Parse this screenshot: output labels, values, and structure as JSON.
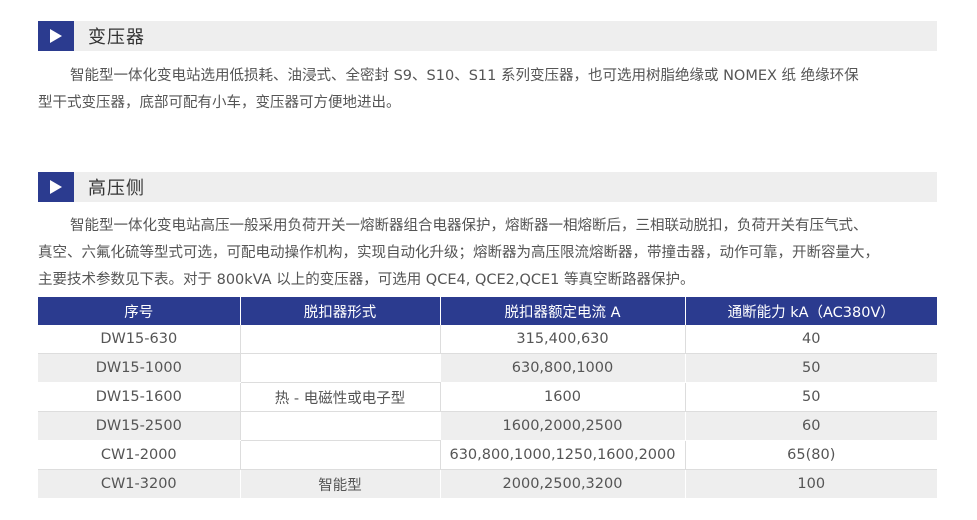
{
  "sections": [
    {
      "title": "变压器",
      "paragraph_lines": [
        "智能型一体化变电站选用低损耗、油浸式、全密封 S9、S10、S11 系列变压器，也可选用树脂绝缘或 NOMEX 纸 绝缘环保",
        "型干式变压器，底部可配有小车，变压器可方便地进出。"
      ]
    },
    {
      "title": "高压侧",
      "paragraph_lines": [
        "智能型一体化变电站高压一般采用负荷开关一熔断器组合电器保护，熔断器一相熔断后，三相联动脱扣，负荷开关有压气式、",
        "真空、六氟化硫等型式可选，可配电动操作机构，实现自动化升级；熔断器为高压限流熔断器，带撞击器，动作可靠，开断容量大，",
        "主要技术参数见下表。对于 800kVA 以上的变压器，可选用 QCE4, QCE2,QCE1 等真空断路器保护。"
      ]
    }
  ],
  "table": {
    "headers": [
      "序号",
      "脱扣器形式",
      "脱扣器额定电流 A",
      "通断能力 kA（AC380V）"
    ],
    "rows": [
      {
        "model": "DW15-630",
        "current": "315,400,630",
        "capacity": "40"
      },
      {
        "model": "DW15-1000",
        "current": "630,800,1000",
        "capacity": "50"
      },
      {
        "model": "DW15-1600",
        "current": "1600",
        "capacity": "50"
      },
      {
        "model": "DW15-2500",
        "current": "1600,2000,2500",
        "capacity": "60"
      },
      {
        "model": "CW1-2000",
        "current": "630,800,1000,1250,1600,2000",
        "capacity": "65(80)"
      },
      {
        "model": "CW1-3200",
        "current": "2000,2500,3200",
        "capacity": "100"
      }
    ],
    "trip_type_merged": "热 - 电磁性或电子型",
    "trip_type_last": "智能型"
  },
  "colors": {
    "accent": "#2b3b8f",
    "header_bg": "#eeeeee",
    "stripe": "#eeeeee"
  },
  "icons": {
    "section_icon": "play-triangle-icon"
  }
}
